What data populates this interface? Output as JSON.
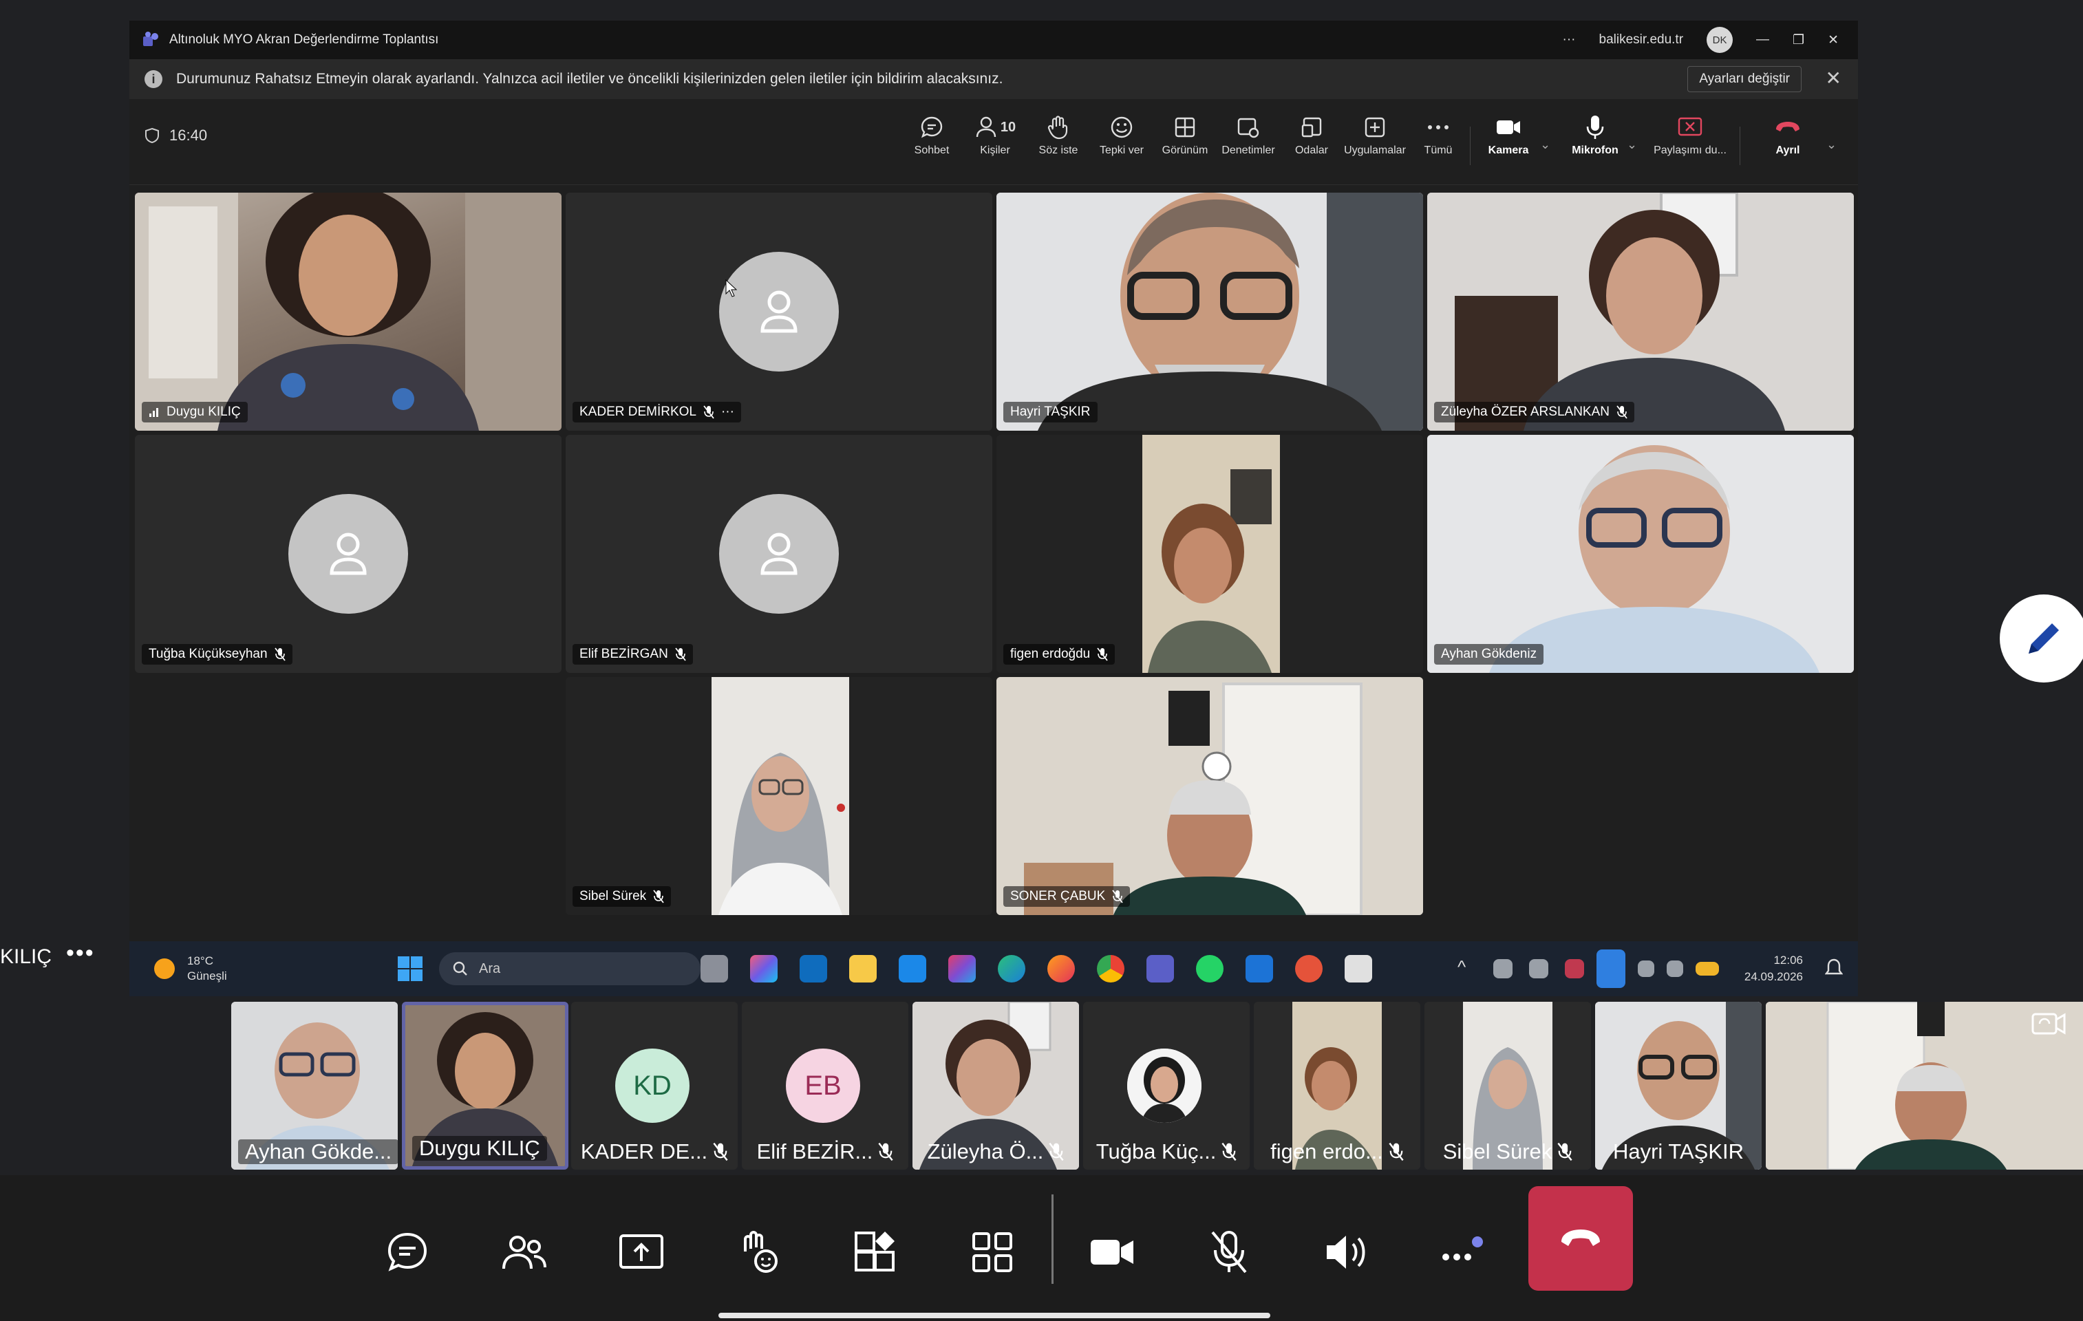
{
  "meeting": {
    "title": "Altınoluk MYO Akran Değerlendirme Toplantısı",
    "more": "···",
    "org": "balikesir.edu.tr",
    "user_initials": "DK",
    "window_min": "—",
    "window_max": "❐",
    "window_close": "✕"
  },
  "banner": {
    "info_glyph": "i",
    "text": "Durumunuz Rahatsız Etmeyin olarak ayarlandı. Yalnızca acil iletiler ve öncelikli kişilerinizden gelen iletiler için bildirim alacaksınız.",
    "button": "Ayarları değiştir",
    "close": "✕"
  },
  "toolbar": {
    "time": "16:40",
    "people_count": "10",
    "items": [
      {
        "label": "Sohbet",
        "icon": "chat-icon"
      },
      {
        "label": "Kişiler",
        "icon": "people-icon"
      },
      {
        "label": "Söz iste",
        "icon": "raise-hand-icon"
      },
      {
        "label": "Tepki ver",
        "icon": "emoji-icon"
      },
      {
        "label": "Görünüm",
        "icon": "view-grid-icon"
      },
      {
        "label": "Denetimler",
        "icon": "controls-icon"
      },
      {
        "label": "Odalar",
        "icon": "rooms-icon"
      },
      {
        "label": "Uygulamalar",
        "icon": "apps-icon"
      },
      {
        "label": "Tümü",
        "icon": "more-icon"
      },
      {
        "label": "Kamera",
        "icon": "camera-icon"
      },
      {
        "label": "Mikrofon",
        "icon": "microphone-icon"
      },
      {
        "label": "Paylaşımı du...",
        "icon": "stop-share-icon"
      },
      {
        "label": "Ayrıl",
        "icon": "leave-icon"
      }
    ]
  },
  "participants": [
    {
      "name": "Duygu KILIÇ",
      "video": true
    },
    {
      "name": "KADER DEMİRKOL",
      "video": false
    },
    {
      "name": "Hayri TAŞKIR",
      "video": true
    },
    {
      "name": "Züleyha ÖZER ARSLANKAN",
      "video": true
    },
    {
      "name": "Tuğba Küçükseyhan",
      "video": false
    },
    {
      "name": "Elif BEZİRGAN",
      "video": false
    },
    {
      "name": "figen erdoğdu",
      "video": true
    },
    {
      "name": "Ayhan Gökdeniz",
      "video": true
    },
    {
      "name": "Sibel Sürek",
      "video": true
    },
    {
      "name": "SONER ÇABUK",
      "video": true
    }
  ],
  "more_dots": "···",
  "taskbar": {
    "temp": "18°C",
    "weather": "Güneşli",
    "search": "Ara",
    "time": "12:06",
    "date": "24.09.2026"
  },
  "mobile": {
    "presenter_label": "KILIÇ",
    "more": "•••",
    "strip": [
      {
        "label": "Ayhan Gökde...",
        "muted": false
      },
      {
        "label": "Duygu KILIÇ",
        "muted": false
      },
      {
        "label": "KADER DE...",
        "initials": "KD",
        "muted": true
      },
      {
        "label": "Elif BEZİR...",
        "initials": "EB",
        "muted": true
      },
      {
        "label": "Züleyha Ö...",
        "muted": true
      },
      {
        "label": "Tuğba Küç...",
        "muted": true
      },
      {
        "label": "figen erdo...",
        "muted": true
      },
      {
        "label": "Sibel Sürek",
        "muted": true
      },
      {
        "label": "Hayri TAŞKIR",
        "muted": false
      }
    ],
    "controls": [
      "chat-icon",
      "people-icon",
      "share-screen-icon",
      "reactions-icon",
      "apps-icon",
      "grid-view-icon",
      "camera-icon",
      "mic-off-icon",
      "speaker-icon",
      "more-icon",
      "hang-up-icon"
    ]
  },
  "colors": {
    "accent": "#6264a7",
    "hangup": "#c4314b",
    "kd_avatar": "#c9ecd9",
    "eb_avatar": "#f6d4e2"
  }
}
